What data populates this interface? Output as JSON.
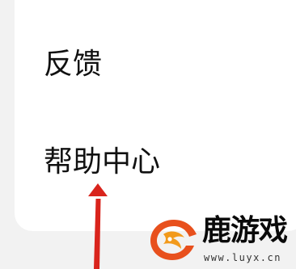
{
  "menu": {
    "items": [
      {
        "label": "反馈"
      },
      {
        "label": "帮助中心"
      }
    ]
  },
  "annotation": {
    "arrow_color": "#d9241c"
  },
  "watermark": {
    "title": "鹿游戏",
    "url": "www.luyx.cn",
    "logo_icon": "deer-head-logo",
    "logo_colors": [
      "#e8501d",
      "#f29a1c"
    ]
  }
}
